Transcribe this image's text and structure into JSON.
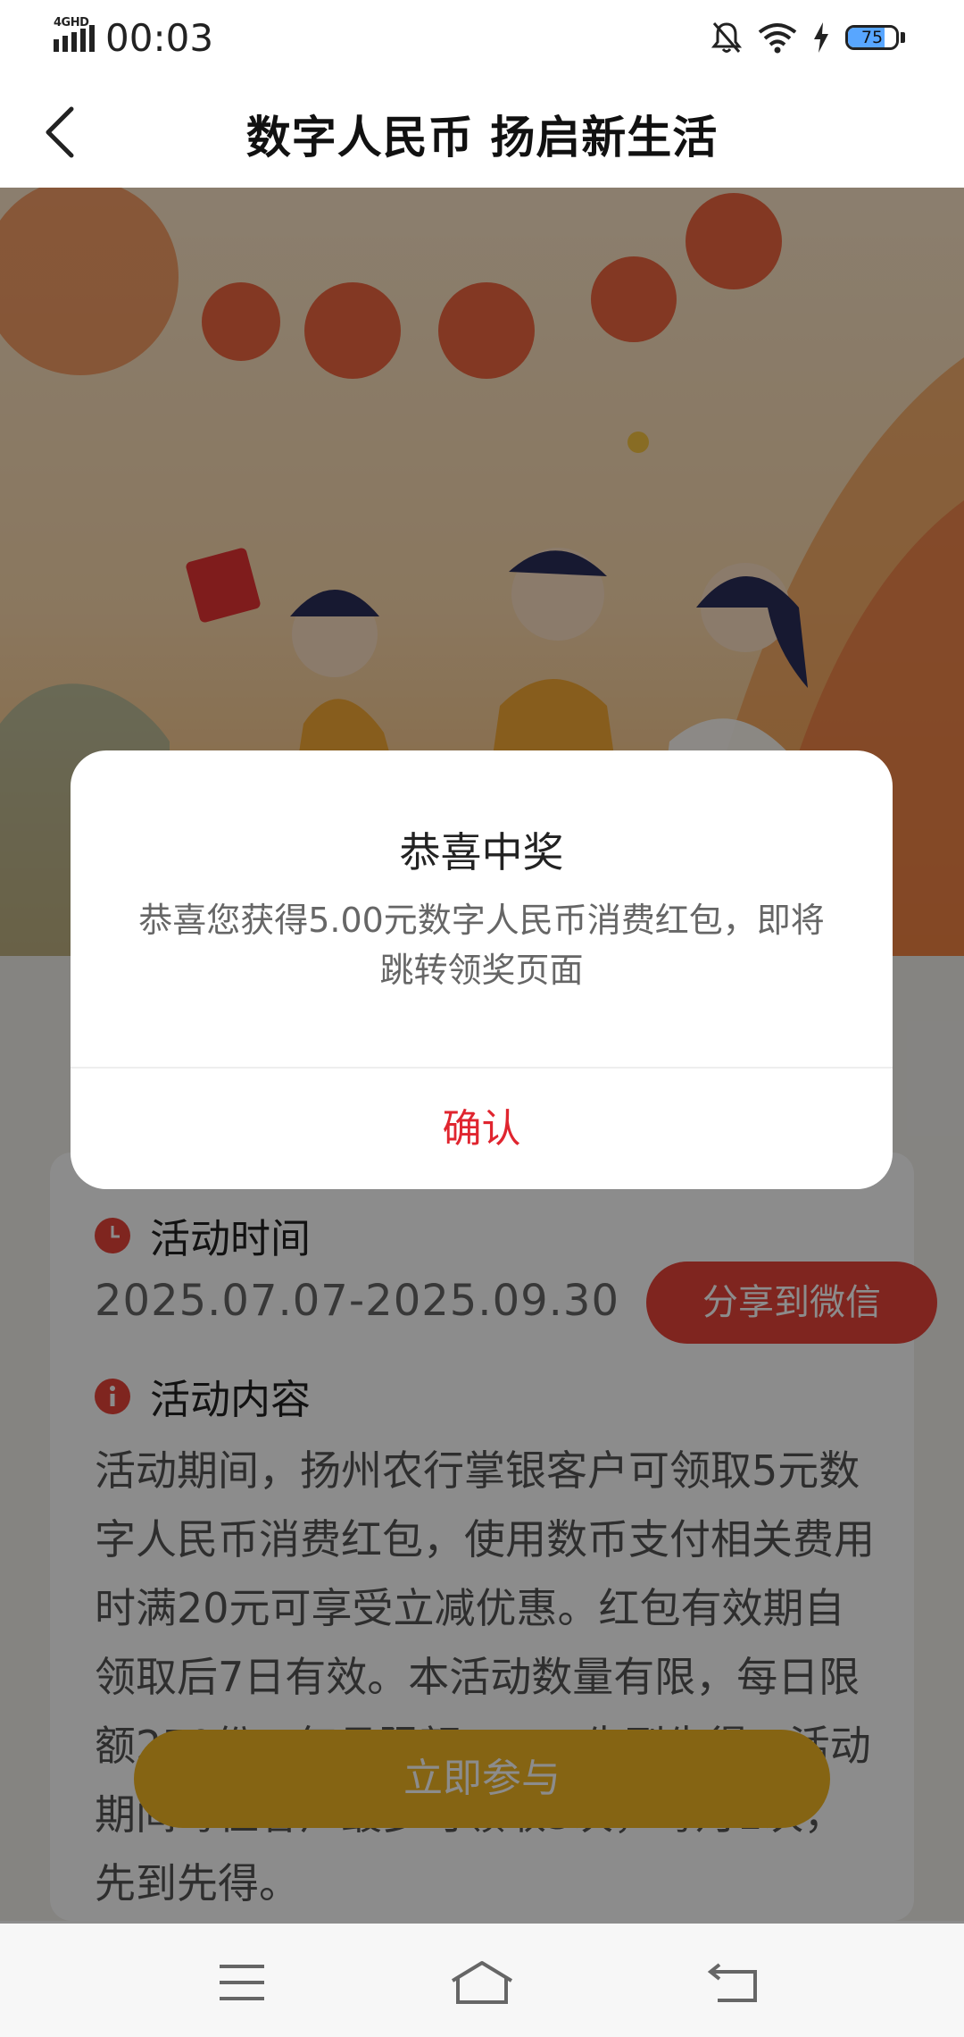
{
  "status_bar": {
    "network_label": "4GHD",
    "time": "00:03",
    "battery_level": "75",
    "battery_fraction": 0.75,
    "icons": [
      "signal-icon",
      "mute-bell-icon",
      "wifi-icon",
      "charging-icon",
      "battery-icon"
    ]
  },
  "header": {
    "title": "数字人民币 扬启新生活",
    "back_icon": "back-arrow-icon"
  },
  "activity": {
    "time_title": "活动时间",
    "dates": "2025.07.07-2025.09.30",
    "share_label": "分享到微信",
    "content_title": "活动内容",
    "description": "活动期间，扬州农行掌银客户可领取5元数字人民币消费红包，使用数币支付相关费用时满20元可享受立减优惠。红包有效期自领取后7日有效。本活动数量有限，每日限额250份，每月限额……，先到先得，活动期间每位客户最多可领取3次，每月1次，先到先得。",
    "join_label": "立即参与"
  },
  "dialog": {
    "title": "恭喜中奖",
    "message": "恭喜您获得5.00元数字人民币消费红包，即将跳转领奖页面",
    "confirm_label": "确认"
  },
  "nav": {
    "icons": [
      "menu-icon",
      "home-icon",
      "back-icon"
    ]
  },
  "colors": {
    "accent_red": "#e8443a",
    "confirm_red": "#e0252f",
    "join_yellow": "#f2b623",
    "battery_blue": "#58a6ff"
  }
}
